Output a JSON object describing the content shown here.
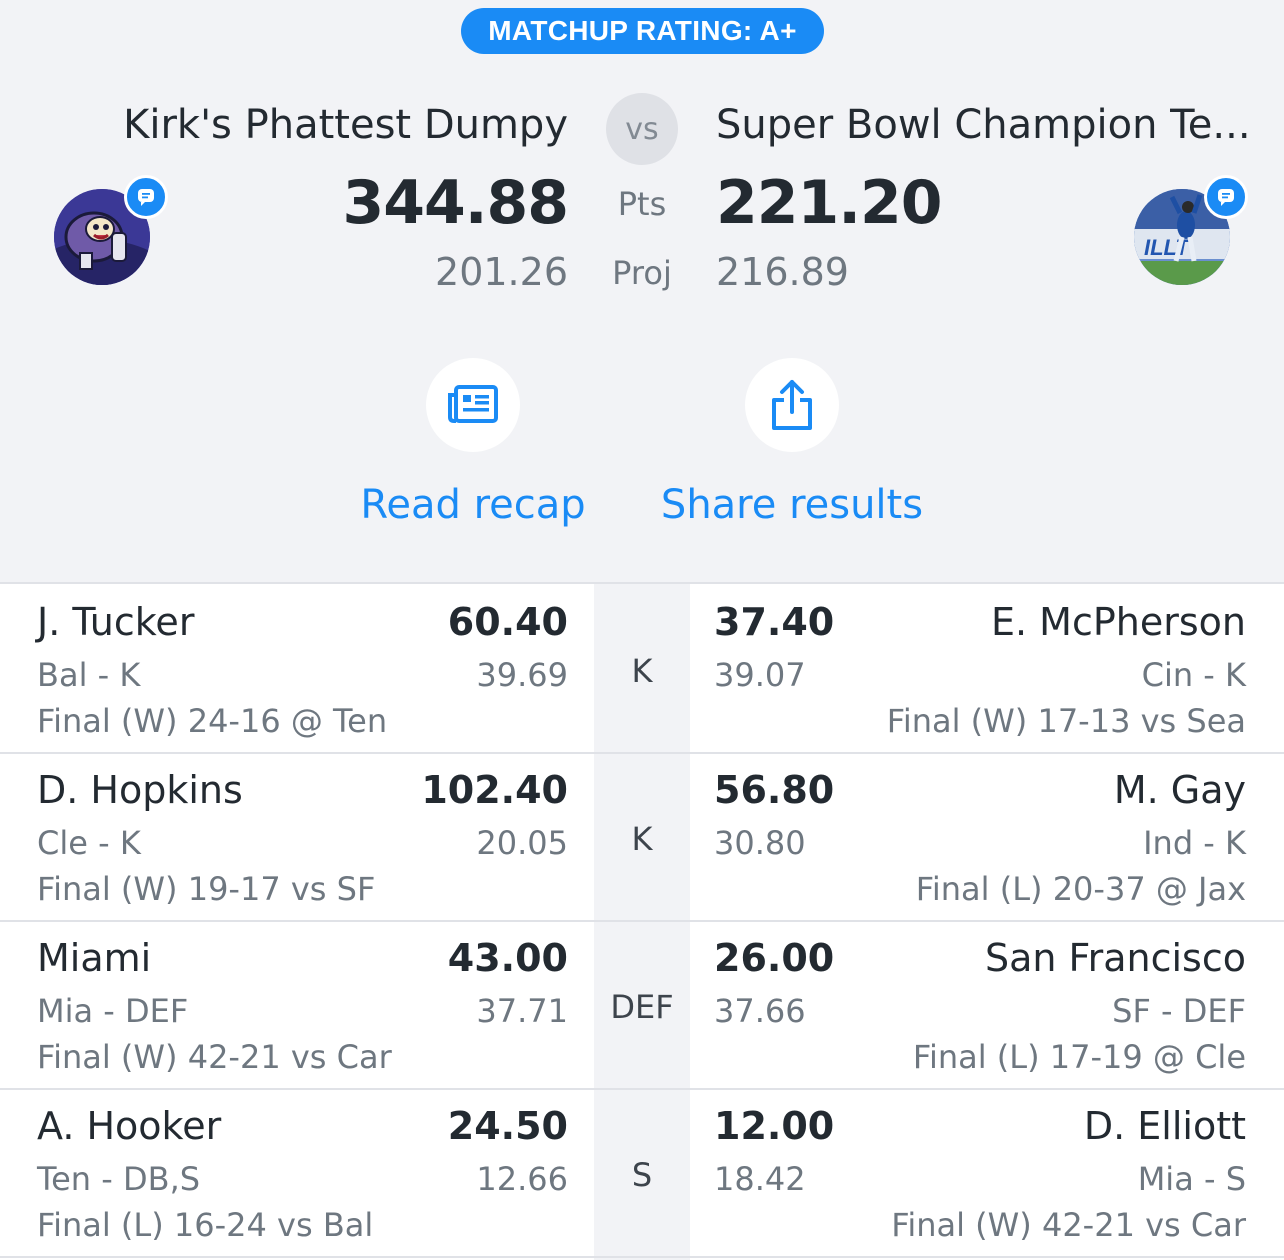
{
  "matchup": {
    "rating_label": "MATCHUP RATING: A+",
    "vs_label": "vs",
    "pts_label": "Pts",
    "proj_label": "Proj"
  },
  "home_team": {
    "name": "Kirk's Phattest Dumpy",
    "points": "344.88",
    "projected": "201.26"
  },
  "away_team": {
    "name": "Super Bowl Champion Te...",
    "points": "221.20",
    "projected": "216.89"
  },
  "actions": {
    "recap_label": "Read recap",
    "share_label": "Share results"
  },
  "colors": {
    "accent": "#1a8bf5",
    "background": "#f2f3f6",
    "text": "#232a31",
    "muted": "#6e7780"
  },
  "rows": [
    {
      "position": "K",
      "left": {
        "name": "J. Tucker",
        "points": "60.40",
        "projected": "39.69",
        "info": "Bal - K",
        "game": "Final (W) 24-16 @ Ten"
      },
      "right": {
        "name": "E. McPherson",
        "points": "37.40",
        "projected": "39.07",
        "info": "Cin - K",
        "game": "Final (W) 17-13 vs Sea"
      }
    },
    {
      "position": "K",
      "left": {
        "name": "D. Hopkins",
        "points": "102.40",
        "projected": "20.05",
        "info": "Cle - K",
        "game": "Final (W) 19-17 vs SF"
      },
      "right": {
        "name": "M. Gay",
        "points": "56.80",
        "projected": "30.80",
        "info": "Ind - K",
        "game": "Final (L) 20-37 @ Jax"
      }
    },
    {
      "position": "DEF",
      "left": {
        "name": "Miami",
        "points": "43.00",
        "projected": "37.71",
        "info": "Mia - DEF",
        "game": "Final (W) 42-21 vs Car"
      },
      "right": {
        "name": "San Francisco",
        "points": "26.00",
        "projected": "37.66",
        "info": "SF - DEF",
        "game": "Final (L) 17-19 @ Cle"
      }
    },
    {
      "position": "S",
      "left": {
        "name": "A. Hooker",
        "points": "24.50",
        "projected": "12.66",
        "info": "Ten - DB,S",
        "game": "Final (L) 16-24 vs Bal"
      },
      "right": {
        "name": "D. Elliott",
        "points": "12.00",
        "projected": "18.42",
        "info": "Mia - S",
        "game": "Final (W) 42-21 vs Car"
      }
    }
  ]
}
